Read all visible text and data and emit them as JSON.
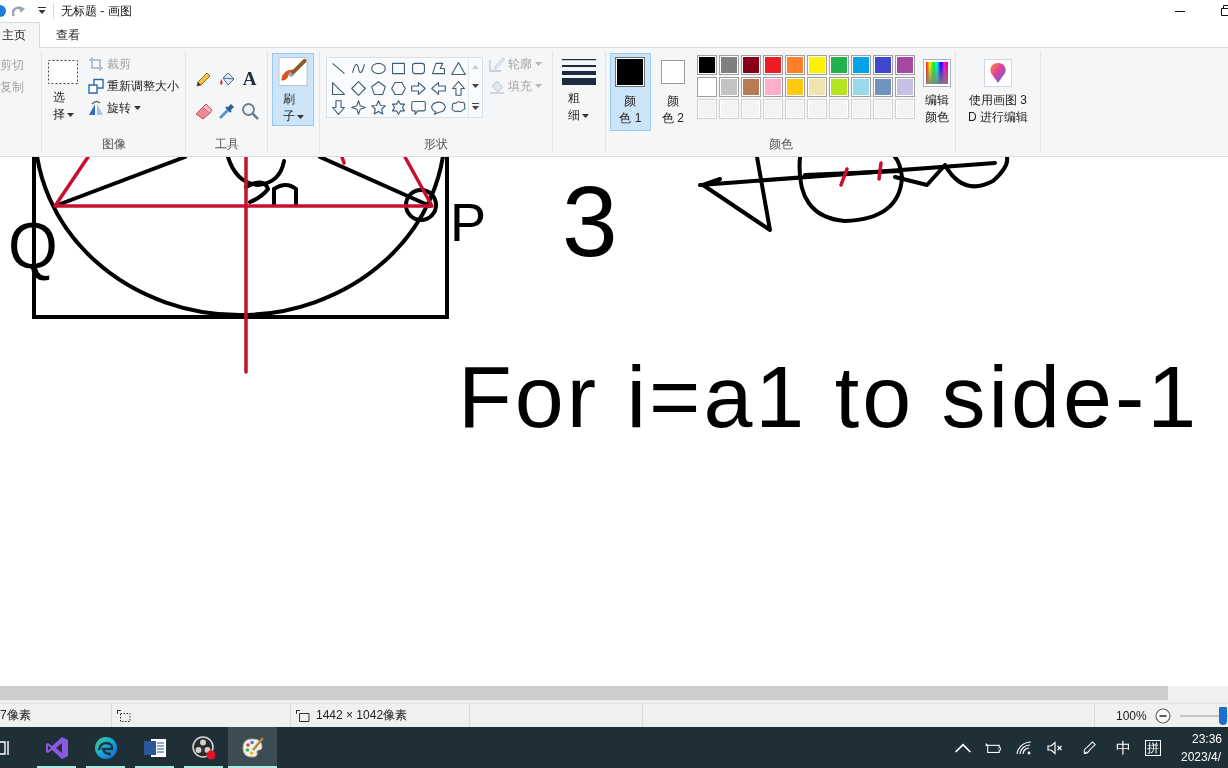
{
  "window": {
    "title": "无标题 - 画图"
  },
  "tabs": [
    {
      "label": "主页",
      "selected": true
    },
    {
      "label": "查看",
      "selected": false
    }
  ],
  "ribbon": {
    "clipboard": {
      "items": [
        {
          "label": "剪切",
          "disabled": true
        },
        {
          "label": "复制",
          "disabled": true
        }
      ]
    },
    "image": {
      "label": "图像",
      "select": {
        "label": "选择",
        "dropdown": true
      },
      "items": [
        {
          "kind": "crop",
          "label": "裁剪",
          "disabled": true,
          "dropdown": false
        },
        {
          "kind": "resize",
          "label": "重新调整大小",
          "disabled": false,
          "dropdown": false
        },
        {
          "kind": "rotate",
          "label": "旋转",
          "disabled": false,
          "dropdown": true
        }
      ]
    },
    "tools": {
      "label": "工具",
      "text_tool": "A"
    },
    "brushes": {
      "label": "刷子",
      "selected": true,
      "dropdown": true
    },
    "shapes": {
      "label": "形状",
      "options": [
        {
          "kind": "outline",
          "label": "轮廓",
          "disabled": true
        },
        {
          "kind": "fill",
          "label": "填充",
          "disabled": true
        }
      ]
    },
    "size": {
      "label": "粗细",
      "dropdown": true
    },
    "colors": {
      "label": "颜色",
      "slots": [
        {
          "label": "颜色 1",
          "color": "#000000",
          "selected": true
        },
        {
          "label": "颜色 2",
          "color": "#ffffff",
          "selected": false
        }
      ],
      "palette": [
        {
          "kind": "swatch",
          "color": "#000000"
        },
        {
          "kind": "swatch",
          "color": "#7f7f7f"
        },
        {
          "kind": "swatch",
          "color": "#880015"
        },
        {
          "kind": "swatch",
          "color": "#ed1c24"
        },
        {
          "kind": "swatch",
          "color": "#ff7f27"
        },
        {
          "kind": "swatch",
          "color": "#fff200"
        },
        {
          "kind": "swatch",
          "color": "#22b14c"
        },
        {
          "kind": "swatch",
          "color": "#00a2e8"
        },
        {
          "kind": "swatch",
          "color": "#3f48cc"
        },
        {
          "kind": "swatch",
          "color": "#a349a4"
        },
        {
          "kind": "swatch",
          "color": "#ffffff"
        },
        {
          "kind": "swatch",
          "color": "#c3c3c3"
        },
        {
          "kind": "swatch",
          "color": "#b97a57"
        },
        {
          "kind": "swatch",
          "color": "#ffaec9"
        },
        {
          "kind": "swatch",
          "color": "#ffc90e"
        },
        {
          "kind": "swatch",
          "color": "#efe4b0"
        },
        {
          "kind": "swatch",
          "color": "#b5e61d"
        },
        {
          "kind": "swatch",
          "color": "#99d9ea"
        },
        {
          "kind": "swatch",
          "color": "#7092be"
        },
        {
          "kind": "swatch",
          "color": "#c8bfe7"
        },
        {
          "kind": "empty"
        },
        {
          "kind": "empty"
        },
        {
          "kind": "empty"
        },
        {
          "kind": "empty"
        },
        {
          "kind": "empty"
        },
        {
          "kind": "empty"
        },
        {
          "kind": "empty"
        },
        {
          "kind": "empty"
        },
        {
          "kind": "empty"
        },
        {
          "kind": "empty"
        }
      ],
      "edit": {
        "label": "编辑颜色"
      }
    },
    "paint3d": {
      "label": "使用画图 3D 进行编辑"
    }
  },
  "canvas": {
    "point_labels": [
      "Q",
      "P"
    ],
    "digit": "3",
    "formula": "For i=a1 to side-1"
  },
  "status_bar": {
    "cursor_position": "7像素",
    "image_size": "1442 × 1042像素",
    "zoom": "100%",
    "zoom_slider": {
      "level": 0.9
    }
  },
  "taskbar": {
    "apps": [
      {
        "kind": "ide",
        "running": true,
        "selected": false
      },
      {
        "kind": "browser",
        "running": true,
        "selected": false
      },
      {
        "kind": "document",
        "running": true,
        "selected": false
      },
      {
        "kind": "recorder",
        "running": true,
        "selected": false
      },
      {
        "kind": "paint",
        "running": true,
        "selected": true
      }
    ],
    "tray": {
      "input_language": "中",
      "input_mode": "拼",
      "time": "23:36",
      "date": "2023/4/"
    }
  }
}
